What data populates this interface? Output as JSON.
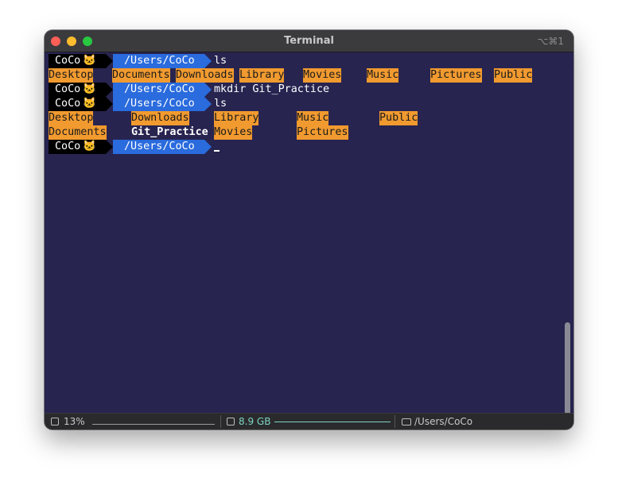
{
  "window": {
    "title": "Terminal",
    "shortcut": "⌥⌘1"
  },
  "prompt": {
    "user": "CoCo",
    "emoji": "🐱",
    "path": "/Users/CoCo"
  },
  "lines": [
    {
      "cmd": "ls"
    },
    {
      "dirs": [
        "Desktop",
        "Documents",
        "Downloads",
        "Library",
        "Movies",
        "Music",
        "Pictures",
        "Public"
      ]
    },
    {
      "cmd": "mkdir Git_Practice"
    },
    {
      "cmd": "ls"
    },
    {
      "dirs": [
        "Desktop",
        "Downloads",
        "Library",
        "Music",
        "Public"
      ]
    },
    {
      "dirs": [
        "Documents",
        "Git_Practice",
        "Movies",
        "Pictures"
      ]
    },
    {
      "cmd": ""
    }
  ],
  "status": {
    "cpu": "13%",
    "memory": "8.9 GB",
    "path": "/Users/CoCo"
  }
}
